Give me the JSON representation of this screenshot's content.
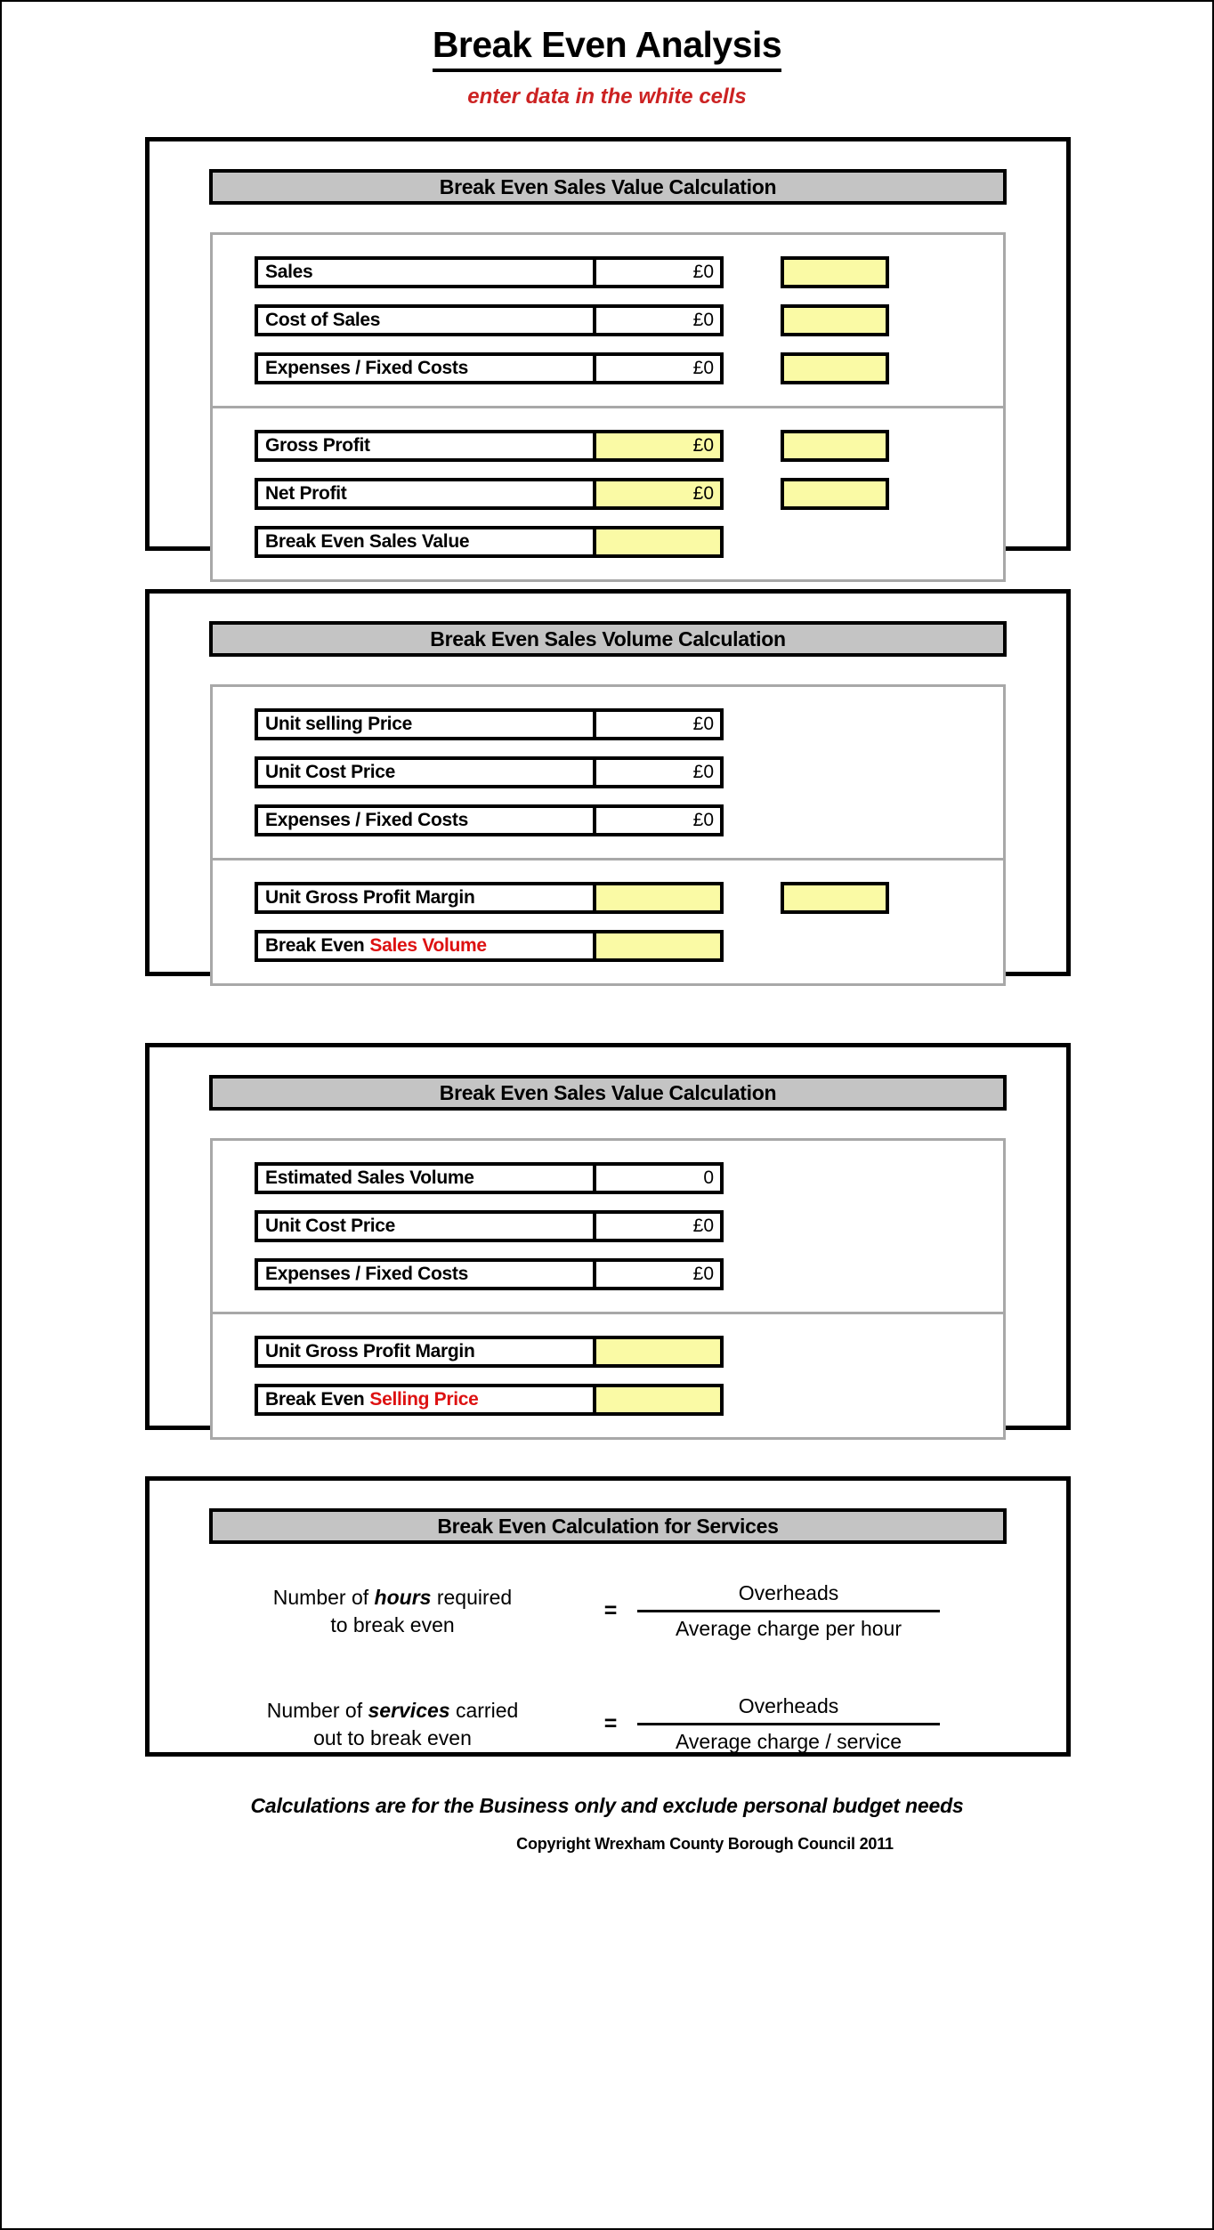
{
  "header": {
    "title": "Break Even Analysis",
    "subtitle": "enter data in the white cells"
  },
  "colors": {
    "input_cell": "#FFFFFF",
    "calculated_cell": "#FAFAA5",
    "section_header_bg": "#C4C4C4",
    "highlight_text": "#DD1111",
    "subtitle_text": "#CC2222",
    "border": "#000000",
    "panel_border": "#A8A8A8"
  },
  "sections": [
    {
      "id": "break-even-sales-value",
      "header": "Break Even Sales Value Calculation",
      "upper_rows": [
        {
          "label": "Sales",
          "value": "£0",
          "value_type": "input",
          "aside": true
        },
        {
          "label": "Cost of Sales",
          "value": "£0",
          "value_type": "input",
          "aside": true
        },
        {
          "label": "Expenses / Fixed Costs",
          "value": "£0",
          "value_type": "input",
          "aside": true
        }
      ],
      "lower_rows": [
        {
          "label": "Gross Profit",
          "value": "£0",
          "value_type": "calculated",
          "aside": true
        },
        {
          "label": "Net Profit",
          "value": "£0",
          "value_type": "calculated",
          "aside": true
        },
        {
          "label": "Break Even Sales Value",
          "value": "",
          "value_type": "calculated",
          "aside": false
        }
      ]
    },
    {
      "id": "break-even-sales-volume",
      "header": "Break Even Sales Volume Calculation",
      "upper_rows": [
        {
          "label": "Unit selling Price",
          "value": "£0",
          "value_type": "input",
          "aside": false
        },
        {
          "label": "Unit Cost Price",
          "value": "£0",
          "value_type": "input",
          "aside": false
        },
        {
          "label": "Expenses / Fixed Costs",
          "value": "£0",
          "value_type": "input",
          "aside": false
        }
      ],
      "lower_rows": [
        {
          "label": "Unit Gross Profit Margin",
          "value": "",
          "value_type": "calculated",
          "aside": true
        },
        {
          "label": "Break Even ",
          "label_highlight": "Sales Volume",
          "value": "",
          "value_type": "calculated",
          "aside": false
        }
      ]
    },
    {
      "id": "break-even-selling-price",
      "header": "Break Even Sales Value Calculation",
      "upper_rows": [
        {
          "label": "Estimated Sales Volume",
          "value": "0",
          "value_type": "input",
          "aside": false
        },
        {
          "label": "Unit Cost Price",
          "value": "£0",
          "value_type": "input",
          "aside": false
        },
        {
          "label": "Expenses / Fixed Costs",
          "value": "£0",
          "value_type": "input",
          "aside": false
        }
      ],
      "lower_rows": [
        {
          "label": "Unit Gross Profit Margin",
          "value": "",
          "value_type": "calculated",
          "aside": false
        },
        {
          "label": "Break Even ",
          "label_highlight": "Selling Price",
          "value": "",
          "value_type": "calculated",
          "aside": false
        }
      ]
    }
  ],
  "services": {
    "header": "Break Even Calculation for Services",
    "formulas": [
      {
        "lhs_pre": "Number of ",
        "lhs_em": "hours",
        "lhs_post": " required",
        "lhs_line2": "to break even",
        "equals": "=",
        "numerator": "Overheads",
        "denominator": "Average charge per hour"
      },
      {
        "lhs_pre": "Number of ",
        "lhs_em": "services",
        "lhs_post": " carried",
        "lhs_line2": "out to break even",
        "equals": "=",
        "numerator": "Overheads",
        "denominator": "Average charge / service"
      }
    ]
  },
  "footer": {
    "note": "Calculations are for the Business only and exclude personal budget needs",
    "copyright": "Copyright Wrexham County Borough Council 2011"
  }
}
